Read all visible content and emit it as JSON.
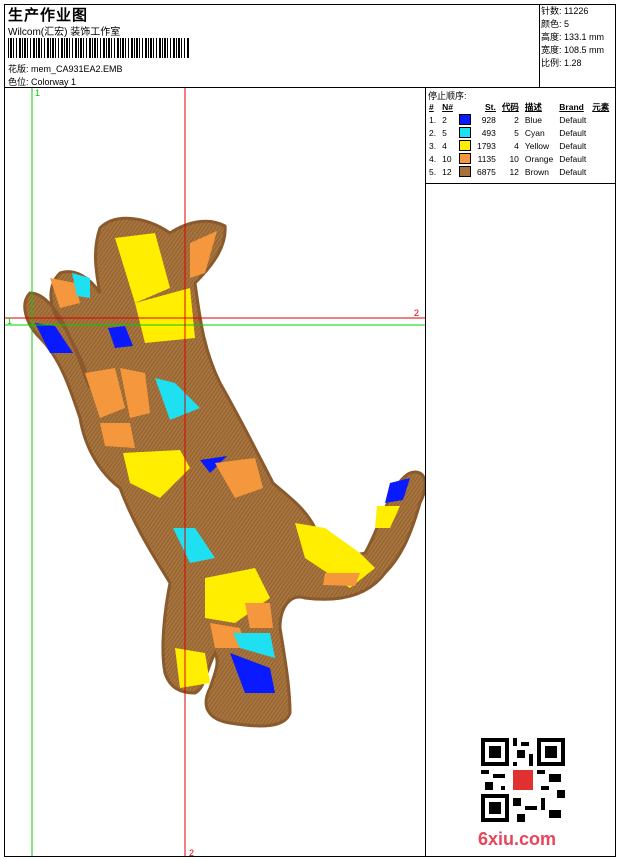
{
  "header": {
    "title": "生产作业图",
    "subtitle": "Wilcom(汇宏) 装饰工作室",
    "design_label": "花版: ",
    "design_file": "mem_CA931EA2.EMB",
    "color_label": "色位: ",
    "colorway": "Colorway 1"
  },
  "stats": {
    "stitches": "针数: 11226",
    "colors": "颜色: 5",
    "height": "高度: 133.1 mm",
    "width": "宽度: 108.5 mm",
    "scale": "比例: 1.28"
  },
  "stop_sequence": {
    "title": "停止顺序:",
    "headers": [
      "#",
      "N#",
      "St.",
      "代码",
      "描述",
      "Brand",
      "元素"
    ],
    "rows": [
      {
        "idx": "1.",
        "n": "2",
        "st": "928",
        "code": "2",
        "desc": "Blue",
        "brand": "Default",
        "color": "#0a1aff"
      },
      {
        "idx": "2.",
        "n": "5",
        "st": "493",
        "code": "5",
        "desc": "Cyan",
        "brand": "Default",
        "color": "#1fe0f0"
      },
      {
        "idx": "3.",
        "n": "4",
        "st": "1793",
        "code": "4",
        "desc": "Yellow",
        "brand": "Default",
        "color": "#ffee00"
      },
      {
        "idx": "4.",
        "n": "10",
        "st": "1135",
        "code": "10",
        "desc": "Orange",
        "brand": "Default",
        "color": "#f5973d"
      },
      {
        "idx": "5.",
        "n": "12",
        "st": "6875",
        "code": "12",
        "desc": "Brown",
        "brand": "Default",
        "color": "#a8703a"
      }
    ]
  },
  "guides": {
    "v1": "1",
    "h1": "1",
    "v2": "2",
    "h2": "2"
  },
  "watermark": "6xiu.com",
  "colors": {
    "guide_green": "#00d000",
    "guide_red": "#e00000",
    "brown": "#9c6b3a"
  }
}
